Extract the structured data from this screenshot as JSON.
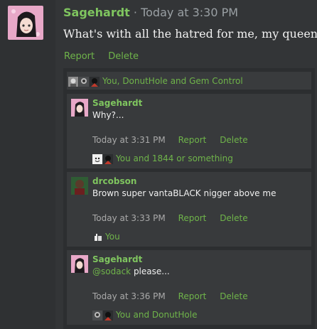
{
  "post": {
    "author": "Sagehardt",
    "separator": " · ",
    "time": "Today at 3:30 PM",
    "body": "What's with all the hatred for me, my queen?",
    "actions": {
      "report": "Report",
      "delete": "Delete"
    }
  },
  "reactions_summary": "You, DonutHole and Gem Control",
  "replies": [
    {
      "author": "Sagehardt",
      "body": "Why?...",
      "time": "Today at 3:31 PM",
      "report": "Report",
      "delete": "Delete",
      "reactions": "You and 1844 or something"
    },
    {
      "author": "drcobson",
      "body": "Brown super vantaBLACK nigger above me",
      "time": "Today at 3:33 PM",
      "report": "Report",
      "delete": "Delete",
      "reactions": "You"
    },
    {
      "author": "Sagehardt",
      "mention": "@sodack",
      "body_after_mention": " please...",
      "time": "Today at 3:36 PM",
      "report": "Report",
      "delete": "Delete",
      "reactions": "You and DonutHole"
    }
  ],
  "colors": {
    "username": "#7fc55f",
    "link": "#6fb44a",
    "background": "#333537",
    "reply_bg": "#383a3c"
  }
}
